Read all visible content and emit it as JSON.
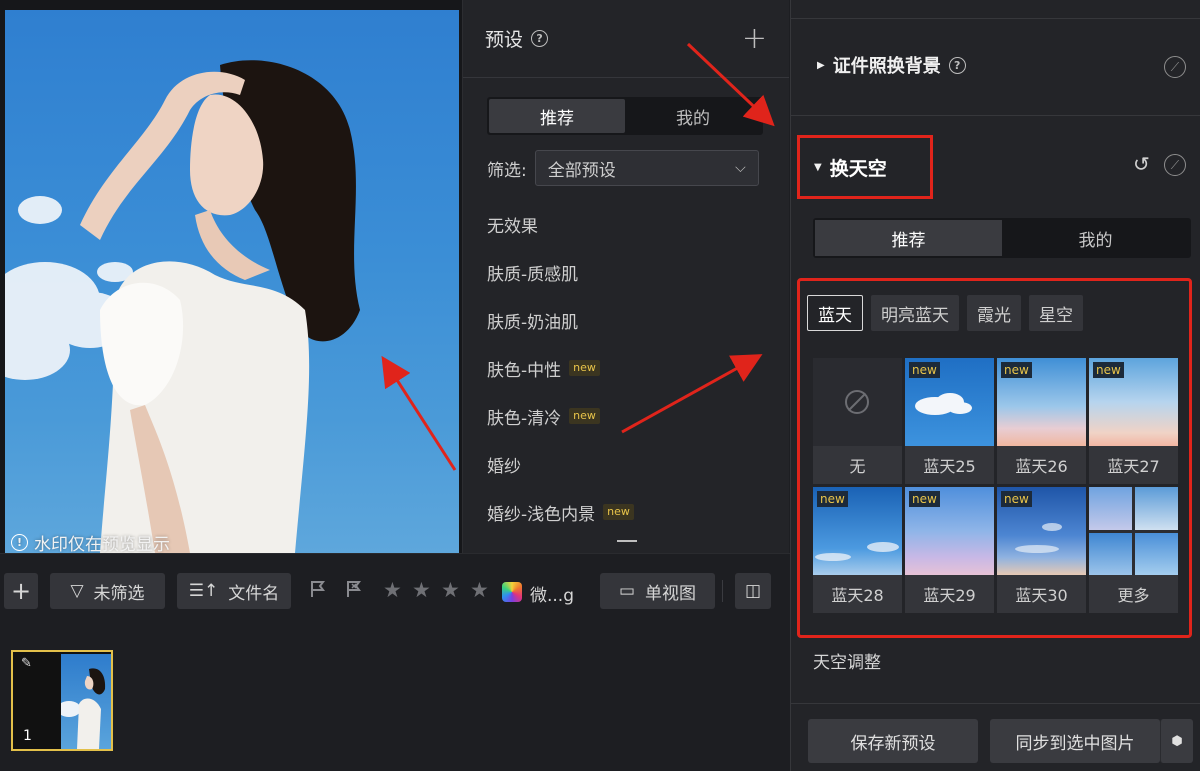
{
  "preview": {
    "watermark": "水印仅在预览显示"
  },
  "presets": {
    "title": "预设",
    "tabs": [
      "推荐",
      "我的"
    ],
    "filter_label": "筛选:",
    "filter_value": "全部预设",
    "items": [
      {
        "label": "无效果",
        "new": ""
      },
      {
        "label": "肤质-质感肌",
        "new": ""
      },
      {
        "label": "肤质-奶油肌",
        "new": ""
      },
      {
        "label": "肤色-中性",
        "new": "new"
      },
      {
        "label": "肤色-清冷",
        "new": "new"
      },
      {
        "label": "婚纱",
        "new": ""
      },
      {
        "label": "婚纱-浅色内景",
        "new": "new"
      }
    ]
  },
  "right_panel": {
    "section_id_photo": "证件照换背景",
    "section_sky": "换天空",
    "sky_tabs": [
      "推荐",
      "我的"
    ],
    "chips": [
      "蓝天",
      "明亮蓝天",
      "霞光",
      "星空"
    ],
    "tiles": [
      {
        "label": "无",
        "new": ""
      },
      {
        "label": "蓝天25",
        "new": "new"
      },
      {
        "label": "蓝天26",
        "new": "new"
      },
      {
        "label": "蓝天27",
        "new": "new"
      },
      {
        "label": "蓝天28",
        "new": "new"
      },
      {
        "label": "蓝天29",
        "new": "new"
      },
      {
        "label": "蓝天30",
        "new": "new"
      },
      {
        "label": "更多",
        "new": ""
      }
    ],
    "sky_adjust": "天空调整",
    "save_preset": "保存新预设",
    "sync_selected": "同步到选中图片"
  },
  "toolbar": {
    "unfiltered": "未筛选",
    "filename": "文件名",
    "color_label": "微...g",
    "single_view": "单视图"
  },
  "filmstrip": {
    "number": "1"
  },
  "colors": {
    "accent_red": "#e0241b",
    "selected_gold": "#c9a23e",
    "new_badge": "#e8c44a"
  }
}
